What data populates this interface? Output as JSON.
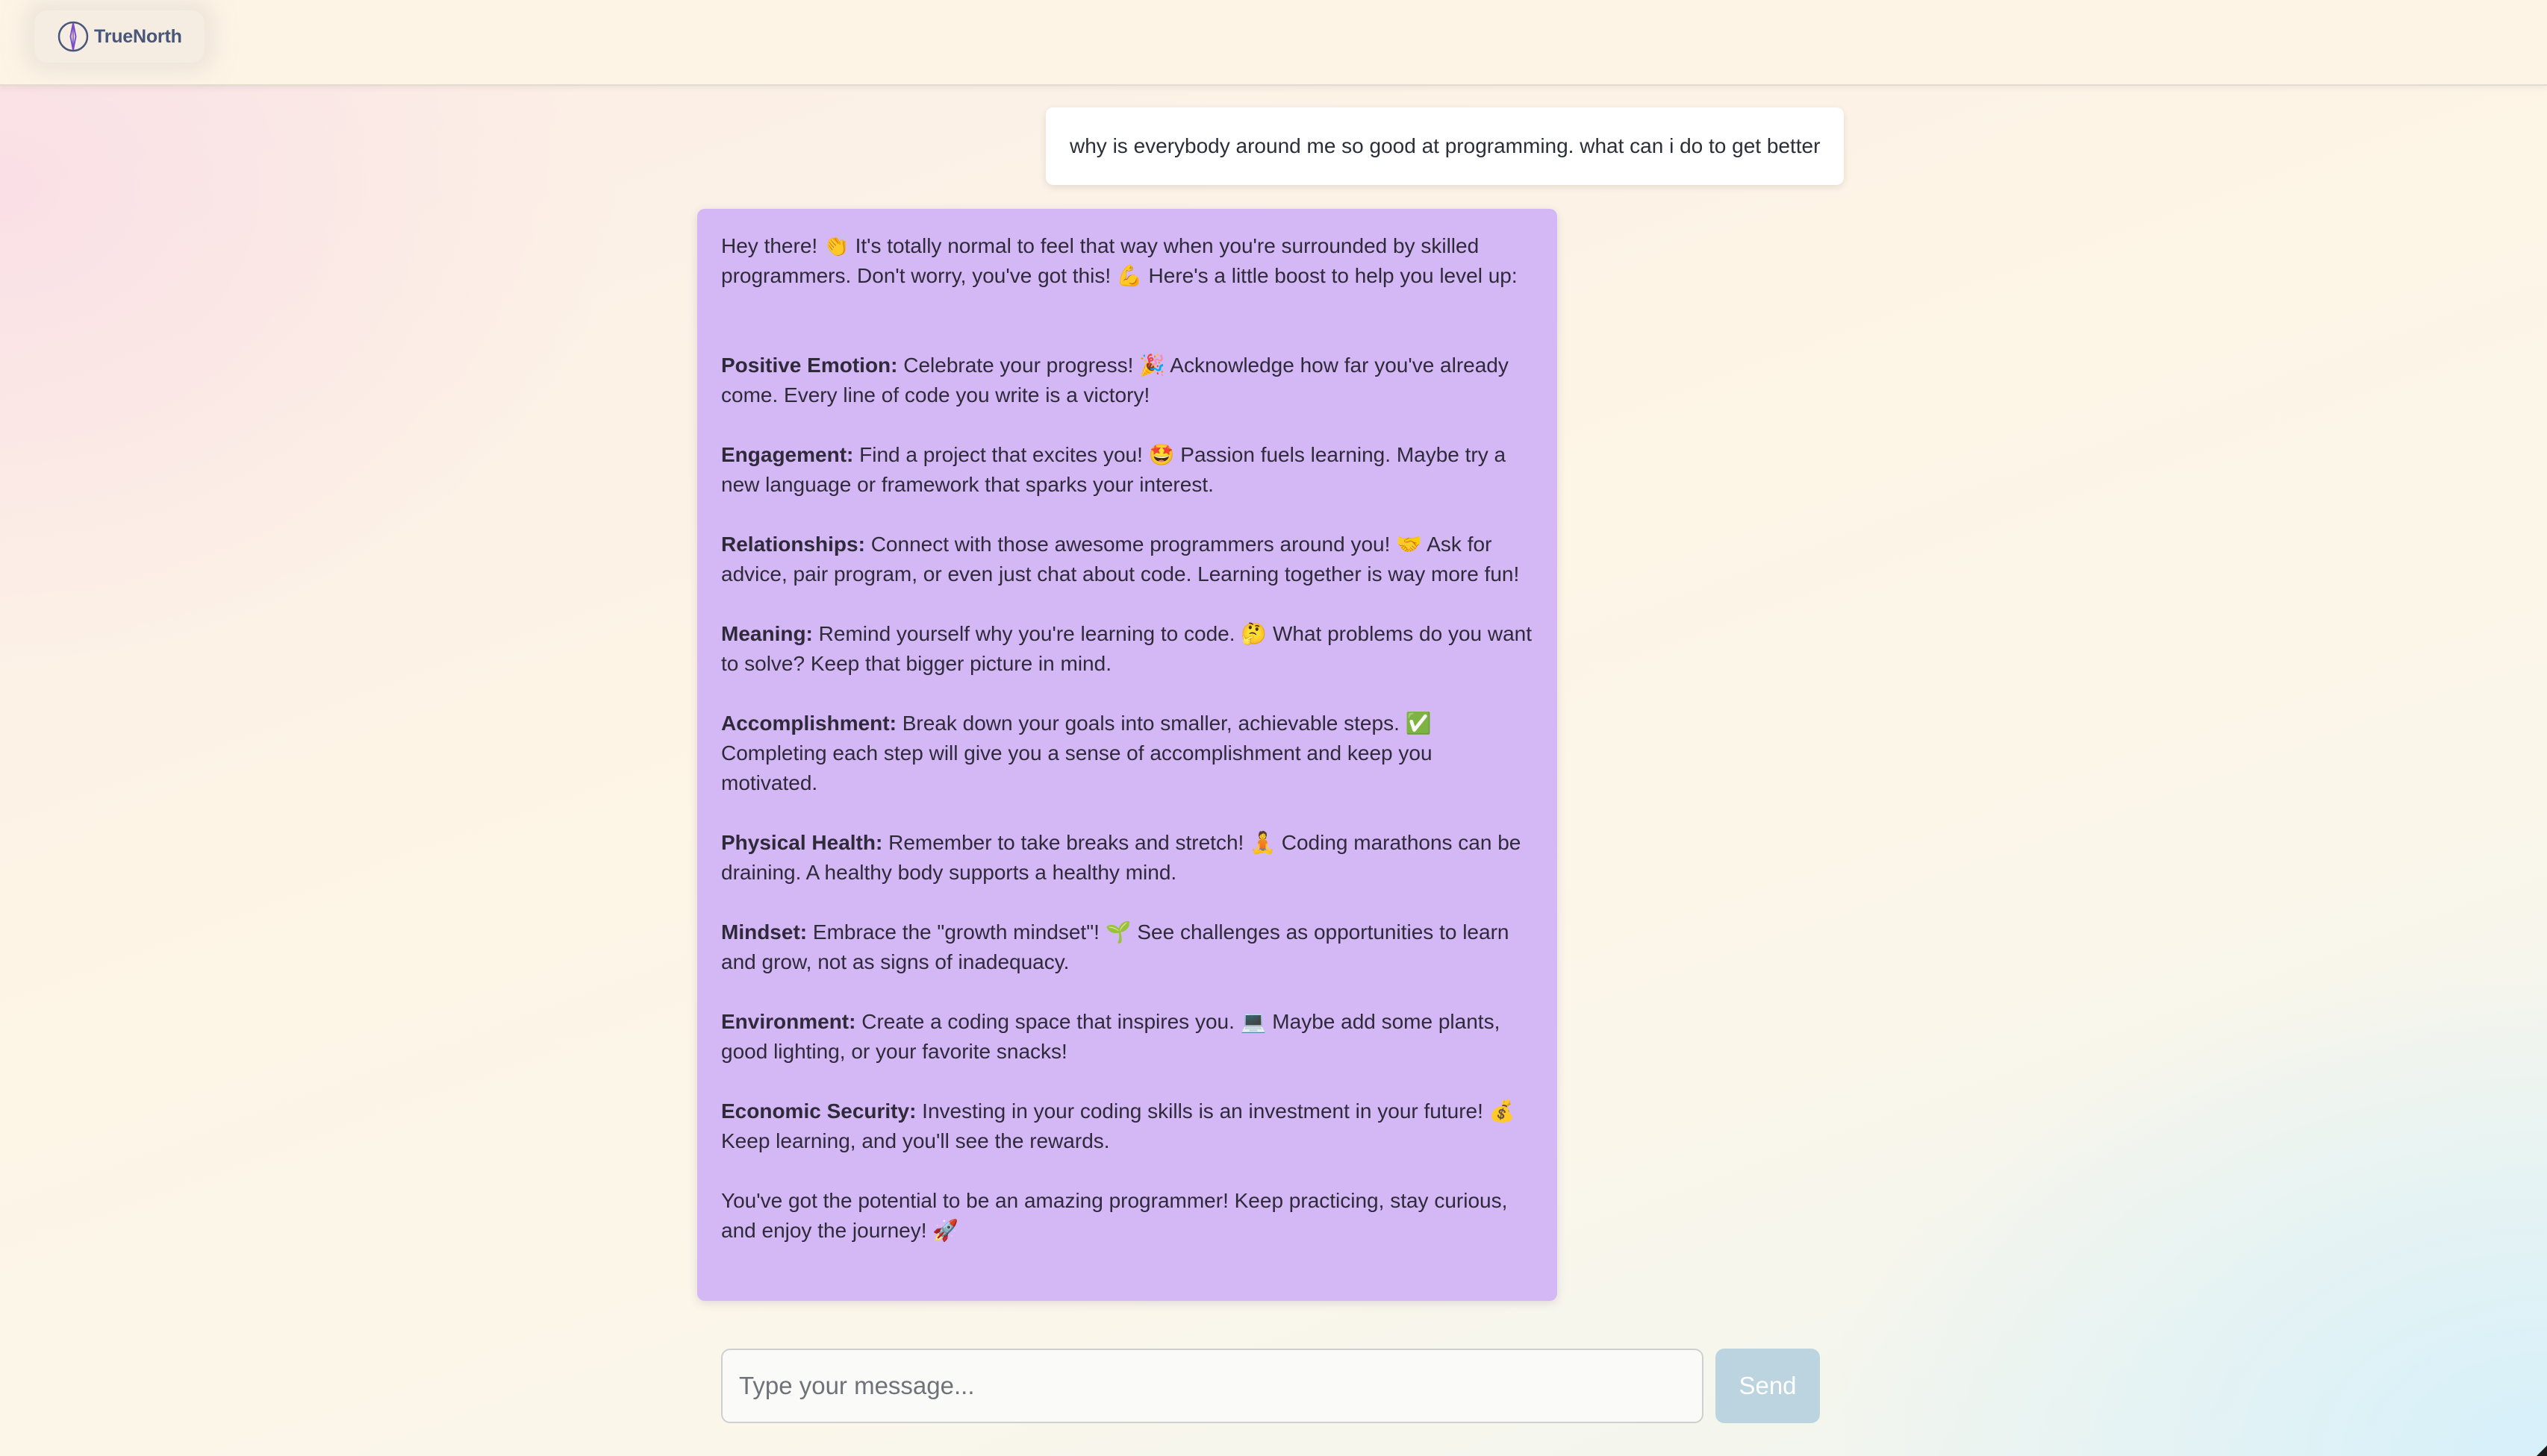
{
  "header": {
    "brand": "TrueNorth",
    "logo_icon": "compass-icon",
    "accent_color": "#48567a"
  },
  "conversation": {
    "user_message": "why is everybody around me so good at programming. what can i do to get better",
    "assistant": {
      "bubble_color": "#d4b8f6",
      "intro": "Hey there! 👏 It's totally normal to feel that way when you're surrounded by skilled programmers. Don't worry, you've got this! 💪 Here's a little boost to help you level up:",
      "tips": [
        {
          "title": "Positive Emotion:",
          "text": " Celebrate your progress! 🎉 Acknowledge how far you've already come. Every line of code you write is a victory!"
        },
        {
          "title": "Engagement:",
          "text": " Find a project that excites you! 🤩 Passion fuels learning. Maybe try a new language or framework that sparks your interest."
        },
        {
          "title": "Relationships:",
          "text": " Connect with those awesome programmers around you! 🤝 Ask for advice, pair program, or even just chat about code. Learning together is way more fun!"
        },
        {
          "title": "Meaning:",
          "text": " Remind yourself why you're learning to code. 🤔 What problems do you want to solve? Keep that bigger picture in mind."
        },
        {
          "title": "Accomplishment:",
          "text": " Break down your goals into smaller, achievable steps. ✅ Completing each step will give you a sense of accomplishment and keep you motivated."
        },
        {
          "title": "Physical Health:",
          "text": " Remember to take breaks and stretch! 🧘 Coding marathons can be draining. A healthy body supports a healthy mind."
        },
        {
          "title": "Mindset:",
          "text": " Embrace the \"growth mindset\"! 🌱 See challenges as opportunities to learn and grow, not as signs of inadequacy."
        },
        {
          "title": "Environment:",
          "text": " Create a coding space that inspires you. 💻 Maybe add some plants, good lighting, or your favorite snacks!"
        },
        {
          "title": "Economic Security:",
          "text": " Investing in your coding skills is an investment in your future! 💰 Keep learning, and you'll see the rewards."
        }
      ],
      "outro": "You've got the potential to be an amazing programmer! Keep practicing, stay curious, and enjoy the journey! 🚀"
    }
  },
  "composer": {
    "placeholder": "Type your message...",
    "value": "",
    "send_label": "Send",
    "send_color": "#bcd4df"
  }
}
